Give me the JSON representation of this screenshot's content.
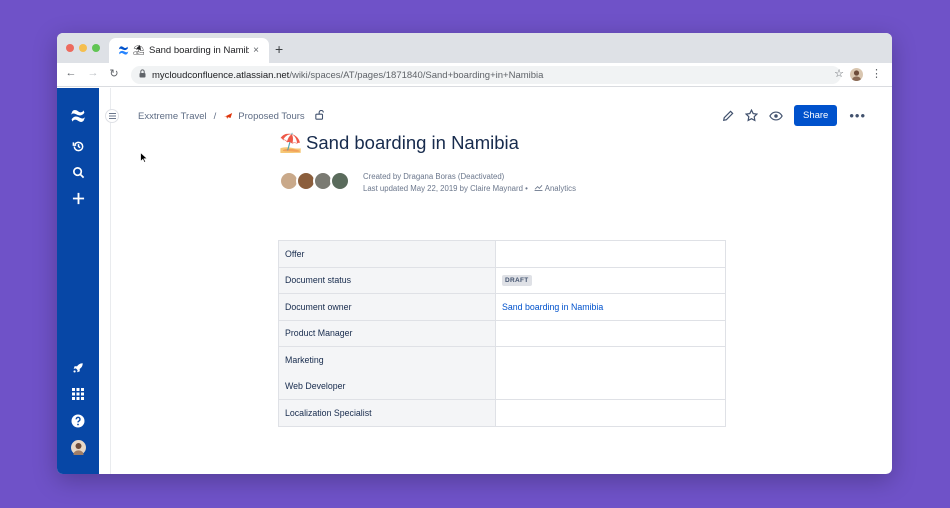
{
  "browser": {
    "tab_title": "Sand boarding in Namibia -",
    "tab_close": "×",
    "new_tab": "+",
    "url_host": "mycloudconfluence.atlassian.net",
    "url_path": "/wiki/spaces/AT/pages/1871840/Sand+boarding+in+Namibia"
  },
  "breadcrumb": {
    "space": "Exxtreme Travel",
    "separator": "/",
    "parent": "Proposed Tours"
  },
  "actions": {
    "share_label": "Share",
    "more_label": "•••"
  },
  "page": {
    "title": "Sand boarding in Namibia",
    "created_by": "Created by Dragana Boras (Deactivated)",
    "last_updated": "Last updated May 22, 2019 by Claire Maynard",
    "bullet": "•",
    "analytics_label": "Analytics"
  },
  "properties": [
    {
      "key": "Offer",
      "value": ""
    },
    {
      "key": "Document status",
      "value": "DRAFT"
    },
    {
      "key": "Document owner",
      "value": "Sand boarding in Namibia"
    },
    {
      "key": "Product Manager",
      "value": ""
    },
    {
      "key": "Marketing",
      "value": ""
    },
    {
      "key": "Web Developer",
      "value": ""
    },
    {
      "key": "Localization Specialist",
      "value": ""
    }
  ],
  "colors": {
    "background": "#6f52c8",
    "sidebar": "#0747a6",
    "primary": "#0052cc",
    "text": "#172b4d",
    "muted": "#6b778c"
  },
  "icons": {
    "sidebar_top": [
      "confluence-logo-icon",
      "recent-icon",
      "search-icon",
      "create-icon"
    ],
    "sidebar_bottom": [
      "rocket-icon",
      "app-switcher-icon",
      "help-icon",
      "profile-avatar"
    ],
    "page_actions": [
      "edit-icon",
      "star-icon",
      "watch-icon"
    ]
  }
}
